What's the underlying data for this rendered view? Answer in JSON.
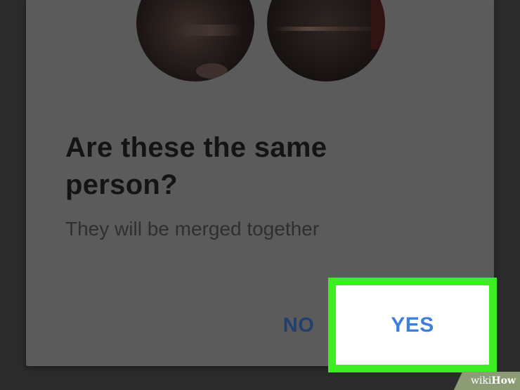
{
  "dialog": {
    "title": "Are these the same person?",
    "subtitle": "They will be merged together",
    "avatars": [
      {
        "name": "face-photo-left"
      },
      {
        "name": "face-photo-right"
      }
    ],
    "buttons": {
      "no_label": "NO",
      "yes_label": "YES"
    }
  },
  "highlight": {
    "color": "#3ded22",
    "target": "yes-button"
  },
  "watermark": {
    "wiki": "wiki",
    "how": "How"
  },
  "colors": {
    "accent_blue": "#3d7fdc",
    "no_button_blue": "#22406e",
    "dialog_bg": "#5b5b5b",
    "page_bg": "#2b2b2b"
  }
}
